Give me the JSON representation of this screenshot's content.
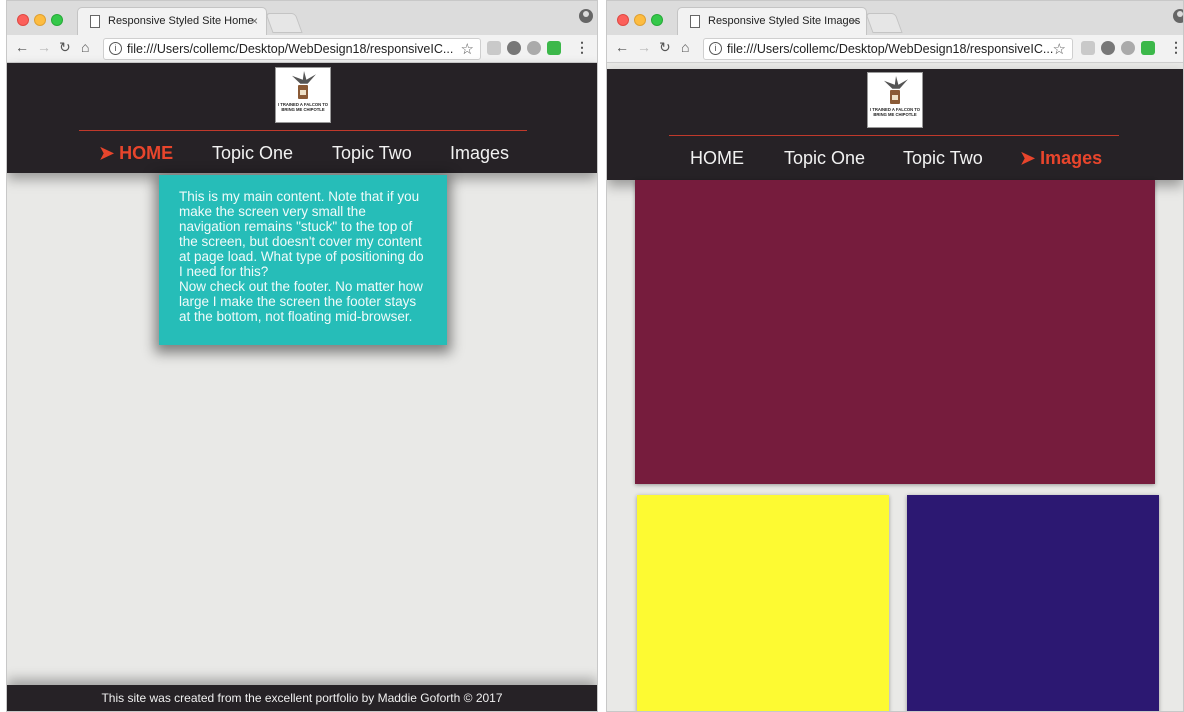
{
  "window_left": {
    "tab_title": "Responsive Styled Site Home",
    "tab_close": "×",
    "url": "file:///Users/collemc/Desktop/WebDesign18/responsiveIC...",
    "logo_text": "I TRAINED A FALCON TO BRING ME CHIPOTLE",
    "nav": [
      {
        "label": "➤ HOME",
        "active": true
      },
      {
        "label": "Topic One",
        "active": false
      },
      {
        "label": "Topic Two",
        "active": false
      },
      {
        "label": "Images",
        "active": false
      }
    ],
    "content": {
      "paragraph_1": "This is my main content. Note that if you make the screen very small the navigation remains \"stuck\" to the top of the screen, but doesn't cover my content at page load. What type of positioning do I need for this?",
      "paragraph_2": "Now check out the footer. No matter how large I make the screen the footer stays at the bottom, not floating mid-browser."
    },
    "footer": "This site was created from the excellent portfolio by Maddie Goforth © 2017"
  },
  "window_right": {
    "tab_title": "Responsive Styled Site Images",
    "tab_close": "×",
    "url": "file:///Users/collemc/Desktop/WebDesign18/responsiveIC...",
    "logo_text": "I TRAINED A FALCON TO BRING ME CHIPOTLE",
    "nav": [
      {
        "label": "HOME",
        "active": false
      },
      {
        "label": "Topic One",
        "active": false
      },
      {
        "label": "Topic Two",
        "active": false
      },
      {
        "label": "➤ Images",
        "active": true
      }
    ],
    "image_blocks": [
      {
        "name": "maroon-image",
        "color": "#761c3d"
      },
      {
        "name": "yellow-image",
        "color": "#fdfa32"
      },
      {
        "name": "indigo-image",
        "color": "#2c1872"
      }
    ]
  },
  "colors": {
    "header_bg": "#262226",
    "accent": "#e8452c",
    "content_bg": "#26bdb8",
    "page_bg": "#e9e9e7"
  }
}
